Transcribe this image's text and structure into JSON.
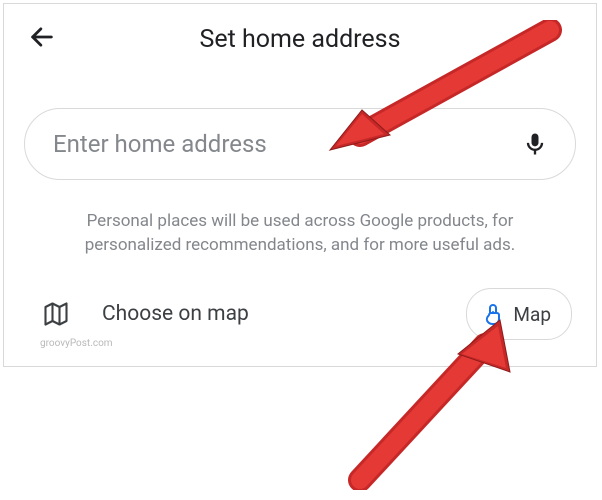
{
  "header": {
    "title": "Set home address"
  },
  "search": {
    "placeholder": "Enter home address",
    "value": ""
  },
  "info_text": "Personal places will be used across Google products, for personalized recommendations, and for more useful ads.",
  "choose": {
    "label": "Choose on map",
    "button_label": "Map"
  },
  "watermark": "groovyPost.com",
  "colors": {
    "touch_icon": "#1a73e8",
    "arrow_fill": "#d32f2f",
    "arrow_stroke": "#9a1f1f"
  }
}
